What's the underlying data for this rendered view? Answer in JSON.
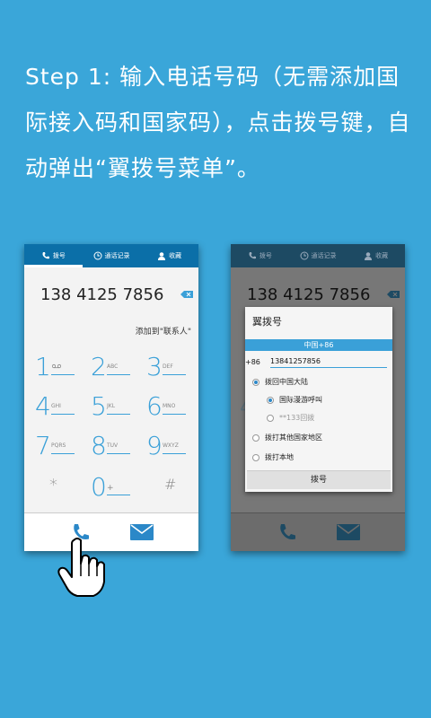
{
  "instruction": {
    "text": "Step 1: 输入电话号码（无需添加国际接入码和国家码），点击拨号键，自动弹出“翼拨号菜单”。"
  },
  "left_phone": {
    "tabs": [
      {
        "label": "拨号",
        "icon": "phone-icon"
      },
      {
        "label": "通话记录",
        "icon": "clock-icon"
      },
      {
        "label": "收藏",
        "icon": "contact-icon"
      }
    ],
    "number": "138 4125 7856",
    "add_contact": "添加到\"联系人\"",
    "keys": [
      {
        "digit": "1",
        "letters": ""
      },
      {
        "digit": "2",
        "letters": "ABC"
      },
      {
        "digit": "3",
        "letters": "DEF"
      },
      {
        "digit": "4",
        "letters": "GHI"
      },
      {
        "digit": "5",
        "letters": "JKL"
      },
      {
        "digit": "6",
        "letters": "MNO"
      },
      {
        "digit": "7",
        "letters": "PQRS"
      },
      {
        "digit": "8",
        "letters": "TUV"
      },
      {
        "digit": "9",
        "letters": "WXYZ"
      },
      {
        "digit": "*",
        "letters": ""
      },
      {
        "digit": "0",
        "letters": "+"
      },
      {
        "digit": "#",
        "letters": ""
      }
    ],
    "bottom_icons": [
      "call-icon",
      "message-icon"
    ]
  },
  "right_phone": {
    "tabs": [
      {
        "label": "拨号"
      },
      {
        "label": "通话记录"
      },
      {
        "label": "收藏"
      }
    ],
    "number": "138 4125 7856",
    "dialog": {
      "title": "翼拨号",
      "country": "中国+86",
      "prefix": "+86",
      "number_value": "13841257856",
      "options": [
        {
          "label": "拨回中国大陆",
          "checked": true
        },
        {
          "label": "国际漫游呼叫",
          "checked": true
        },
        {
          "label": "**133回拨",
          "checked": false
        },
        {
          "label": "拨打其他国家地区",
          "checked": false
        },
        {
          "label": "拨打本地",
          "checked": false
        }
      ],
      "button_label": "拨号"
    }
  },
  "colors": {
    "background": "#3aa6d9",
    "accent": "#3aa0d8",
    "tab_bar": "#0b6fa8"
  }
}
